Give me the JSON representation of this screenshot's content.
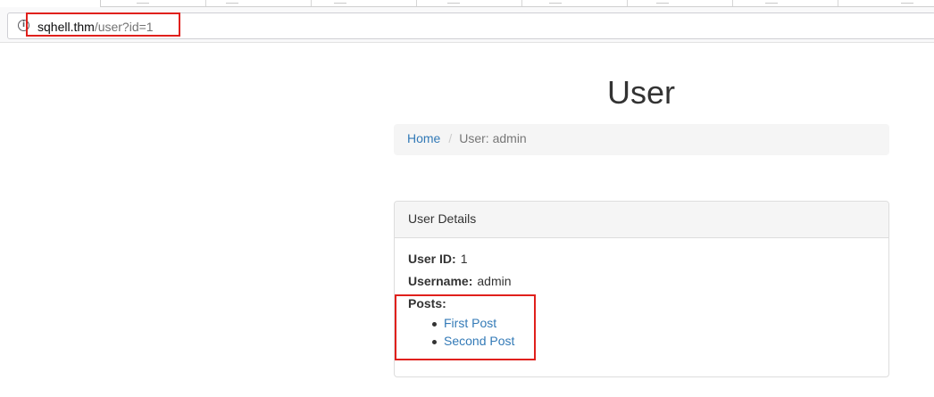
{
  "browser": {
    "url_host": "sqhell.thm",
    "url_path": "/user?id=1",
    "info_icon": "info-icon"
  },
  "page": {
    "title": "User"
  },
  "breadcrumb": {
    "home": "Home",
    "separator": "/",
    "current": "User: admin"
  },
  "panel": {
    "heading": "User Details",
    "user_id_label": "User ID:",
    "user_id_value": "1",
    "username_label": "Username:",
    "username_value": "admin",
    "posts_label": "Posts:",
    "posts": [
      "First Post",
      "Second Post"
    ]
  },
  "colors": {
    "link": "#337ab7",
    "highlight": "#e0201c",
    "breadcrumb_bg": "#f5f5f5"
  }
}
